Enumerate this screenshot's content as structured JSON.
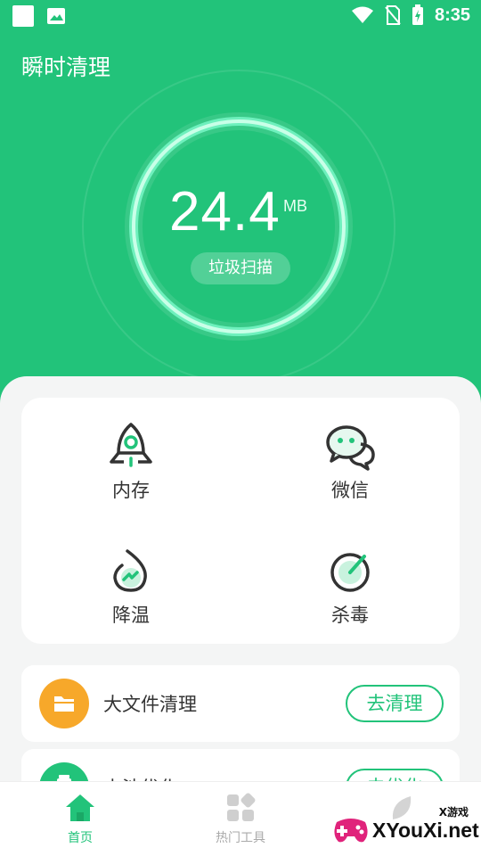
{
  "status_bar": {
    "time": "8:35"
  },
  "app": {
    "title": "瞬时清理"
  },
  "scan": {
    "value": "24.4",
    "unit": "MB",
    "button": "垃圾扫描"
  },
  "grid": {
    "items": [
      {
        "label": "内存",
        "icon": "rocket-icon"
      },
      {
        "label": "微信",
        "icon": "wechat-icon"
      },
      {
        "label": "降温",
        "icon": "cooling-drop-icon"
      },
      {
        "label": "杀毒",
        "icon": "antivirus-gauge-icon"
      }
    ]
  },
  "tools": [
    {
      "title": "大文件清理",
      "button": "去清理",
      "icon": "folder-icon",
      "color": "#f7a82a"
    },
    {
      "title": "电池优化",
      "button": "去优化",
      "icon": "battery-icon",
      "color": "#22c37a"
    }
  ],
  "nav": {
    "items": [
      {
        "label": "首页",
        "active": true,
        "icon": "home-icon"
      },
      {
        "label": "热门工具",
        "active": false,
        "icon": "tools-grid-icon"
      },
      {
        "label": "",
        "active": false,
        "icon": "leaf-icon"
      }
    ]
  },
  "watermark": {
    "sub": "X游戏",
    "main": "XYouXi.net"
  },
  "colors": {
    "brand": "#22c37a",
    "accent_orange": "#f7a82a",
    "text": "#333333"
  }
}
